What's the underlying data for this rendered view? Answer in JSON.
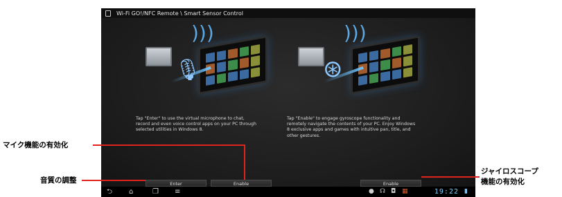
{
  "window": {
    "title": "Wi-Fi GO!/NFC Remote \\ Smart Sensor Control"
  },
  "left_panel": {
    "description": "Tap \"Enter\" to use the virtual microphone to chat, record and even voice control apps on your PC through selected utilities in Windows 8.",
    "enter_label": "Enter",
    "enable_label": "Enable"
  },
  "right_panel": {
    "description": "Tap \"Enable\" to engage gyroscope functionality and remotely navigate the contents of your PC. Enjoy Windows 8 exclusive apps and games with intuitive pan, title, and other gestures.",
    "enable_label": "Enable"
  },
  "navbar": {
    "clock": "19:22"
  },
  "callouts": {
    "mic": "マイク機能の有効化",
    "sound": "音質の調整",
    "gyro_line1": "ジャイロスコープ",
    "gyro_line2": "機能の有効化"
  },
  "colors": {
    "accent": "#e0231f",
    "screen_bg": "#1e1e1e",
    "clock": "#7fd0ff"
  }
}
